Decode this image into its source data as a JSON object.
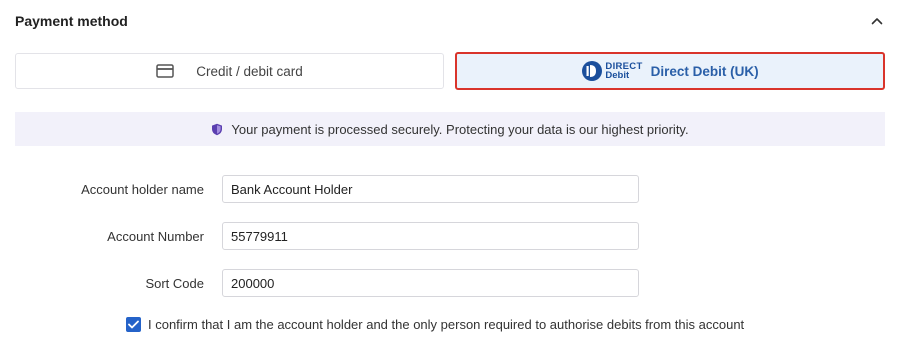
{
  "section": {
    "title": "Payment method"
  },
  "methods": {
    "credit_label": "Credit / debit card",
    "direct_debit_label": "Direct Debit (UK)",
    "direct_debit_logo_line1": "DIRECT",
    "direct_debit_logo_line2": "Debit"
  },
  "security": {
    "message": "Your payment is processed securely. Protecting your data is our highest priority."
  },
  "form": {
    "account_holder_label": "Account holder name",
    "account_holder_value": "Bank Account Holder",
    "account_number_label": "Account Number",
    "account_number_value": "55779911",
    "sort_code_label": "Sort Code",
    "sort_code_value": "200000"
  },
  "confirm": {
    "checked": true,
    "text": "I confirm that I am the account holder and the only person required to authorise debits from this account"
  },
  "colors": {
    "selected_border": "#d9342b",
    "selected_bg": "#eaf2fb",
    "accent": "#2563c9",
    "banner_bg": "#f2f1fa"
  },
  "icons": {
    "collapse": "chevron-up-icon",
    "card": "credit-card-icon",
    "direct_debit": "direct-debit-logo",
    "shield": "shield-icon",
    "check": "checkmark-icon"
  }
}
